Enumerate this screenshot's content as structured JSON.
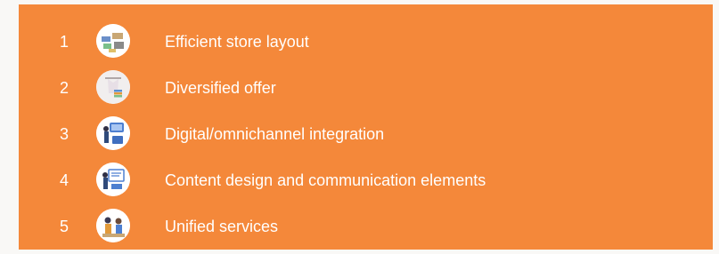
{
  "colors": {
    "background": "#f9f8f6",
    "panel": "#f4883a",
    "text": "#ffffff"
  },
  "items": [
    {
      "number": "1",
      "icon": "store-layout-icon",
      "label": "Efficient store layout"
    },
    {
      "number": "2",
      "icon": "clothing-rack-icon",
      "label": "Diversified offer"
    },
    {
      "number": "3",
      "icon": "omnichannel-icon",
      "label": "Digital/omnichannel integration"
    },
    {
      "number": "4",
      "icon": "presentation-board-icon",
      "label": "Content design and communication elements"
    },
    {
      "number": "5",
      "icon": "customer-service-icon",
      "label": "Unified services"
    }
  ]
}
